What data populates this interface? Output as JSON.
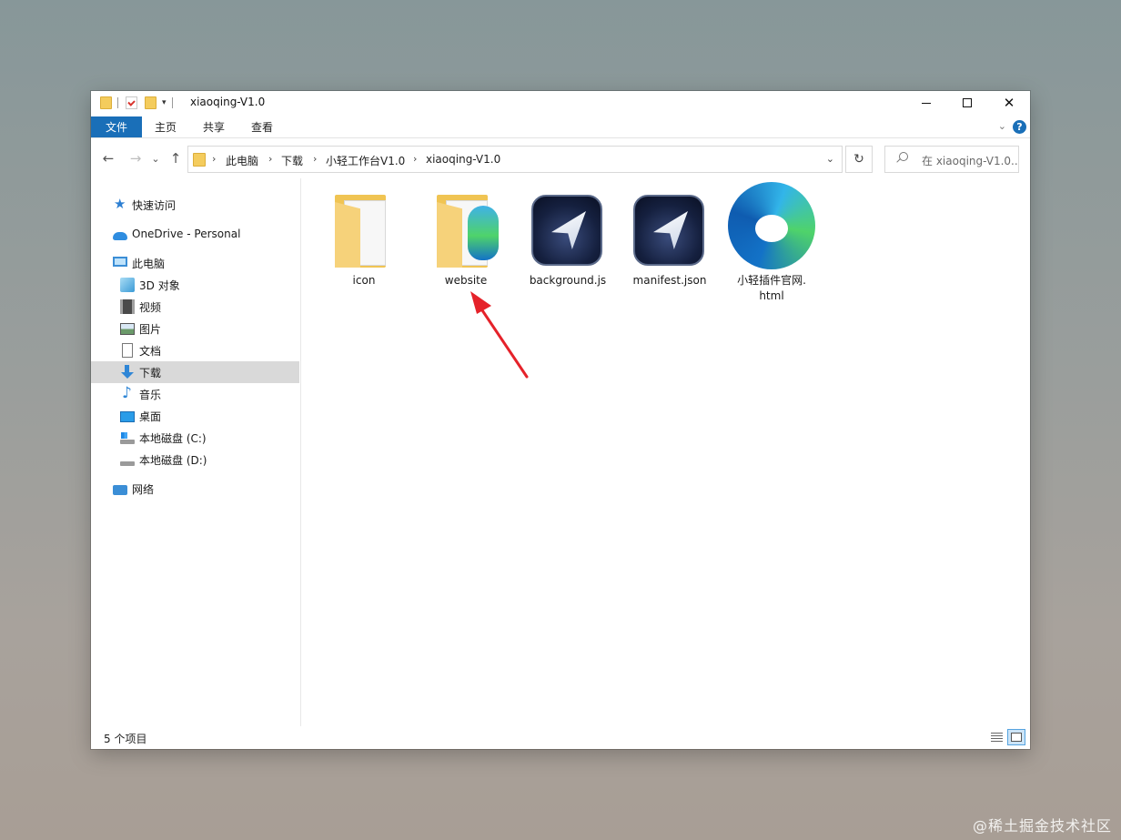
{
  "window": {
    "title": "xiaoqing-V1.0",
    "minimize_glyph": "",
    "close_glyph": "✕"
  },
  "ribbon": {
    "tabs": [
      "文件",
      "主页",
      "共享",
      "查看"
    ],
    "help_glyph": "?"
  },
  "nav": {
    "back_glyph": "←",
    "forward_glyph": "→",
    "recent_glyph": "⌄",
    "up_glyph": "↑",
    "refresh_glyph": "↻",
    "breadcrumb": [
      "此电脑",
      "下载",
      "小轻工作台V1.0",
      "xiaoqing-V1.0"
    ],
    "separator": "›",
    "dropdown_glyph": "⌄",
    "search_placeholder": "在 xiaoqing-V1.0..."
  },
  "sidebar": {
    "items": [
      {
        "label": "快速访问",
        "icon": "star-icon"
      },
      {
        "label": "OneDrive - Personal",
        "icon": "cloud-icon"
      },
      {
        "label": "此电脑",
        "icon": "computer-icon"
      },
      {
        "label": "3D 对象",
        "icon": "3d-objects-icon"
      },
      {
        "label": "视频",
        "icon": "video-icon"
      },
      {
        "label": "图片",
        "icon": "picture-icon"
      },
      {
        "label": "文档",
        "icon": "document-icon"
      },
      {
        "label": "下载",
        "icon": "download-icon",
        "selected": true
      },
      {
        "label": "音乐",
        "icon": "music-icon"
      },
      {
        "label": "桌面",
        "icon": "desktop-icon"
      },
      {
        "label": "本地磁盘 (C:)",
        "icon": "drive-c-icon"
      },
      {
        "label": "本地磁盘 (D:)",
        "icon": "drive-d-icon"
      },
      {
        "label": "网络",
        "icon": "network-icon"
      }
    ]
  },
  "files": [
    {
      "name": "icon",
      "type": "folder"
    },
    {
      "name": "website",
      "type": "folder"
    },
    {
      "name": "background.js",
      "type": "js"
    },
    {
      "name": "manifest.json",
      "type": "json"
    },
    {
      "name_line1": "小轻插件官网.",
      "name_line2": "html",
      "type": "html"
    }
  ],
  "status": {
    "item_count": "5 个项目"
  },
  "watermark": "@稀土掘金技术社区",
  "colors": {
    "accent": "#1a6fb8",
    "selected_bg": "#d9d9d9",
    "annotation_arrow": "#e5222a"
  }
}
